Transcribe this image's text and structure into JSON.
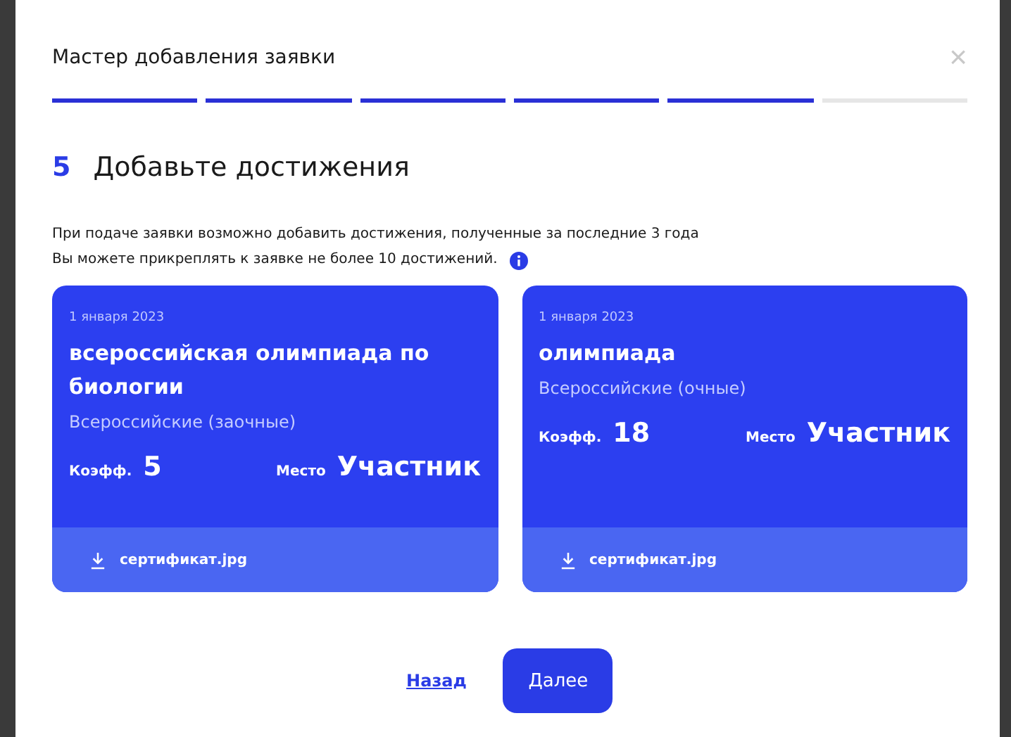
{
  "dialog": {
    "title": "Мастер добавления заявки",
    "close": "×"
  },
  "steps": [
    {
      "done": true
    },
    {
      "done": true
    },
    {
      "done": true
    },
    {
      "done": true
    },
    {
      "done": true
    },
    {
      "done": false
    }
  ],
  "heading": {
    "number": "5",
    "title": "Добавьте достижения"
  },
  "notes": [
    "При подаче заявки возможно добавить достижения, полученные за последние 3 года",
    "Вы можете прикреплять к заявке не более 10 достижений."
  ],
  "achievements": [
    {
      "date": "1 января 2023",
      "title": "всероссийская олимпиада по биологии",
      "level": "Всероссийские (заочные)",
      "coef_label": "Коэфф.",
      "coef": "5",
      "place_label": "Место",
      "place": "Участник",
      "file": "сертификат.jpg"
    },
    {
      "date": "1 января 2023",
      "title": "олимпиада",
      "level": "Всероссийские (очные)",
      "coef_label": "Коэфф.",
      "coef": "18",
      "place_label": "Место",
      "place": "Участник",
      "file": "сертификат.jpg"
    }
  ],
  "buttons": {
    "back": "Назад",
    "next": "Далее"
  }
}
